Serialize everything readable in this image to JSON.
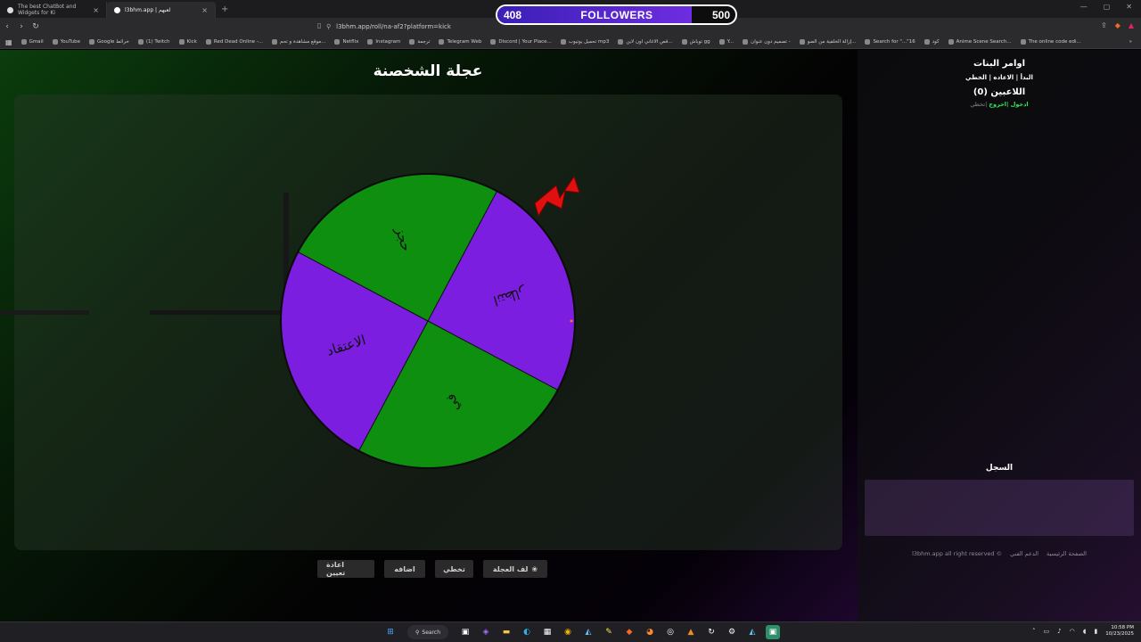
{
  "browser": {
    "tabs": [
      {
        "label": "The best ChatBot and Widgets for Ki"
      },
      {
        "label": "l3bhm.app | لعبهم"
      }
    ],
    "url": "l3bhm.app/roll/na-af2?platform=kick",
    "bookmarks": [
      "Gmail",
      "YouTube",
      "Google خرائط",
      "(1) Twitch",
      "Kick",
      "Red Dead Online -...",
      "موقع مشاهدة و تحم...",
      "Netflix",
      "Instagram",
      "ترجمة",
      "Telegram Web",
      "Discord | Your Place...",
      "تحميل يوتيوب mp3",
      "قص الاغاني اون لاين...",
      "توباش gg",
      "Y...",
      "تصميم دون عنوان -",
      "إزالة الخلفية من الصو...",
      "Search for \"...\"16",
      "كود",
      "Anime Scene Search...",
      "The online code edi..."
    ]
  },
  "followers_widget": {
    "current": "408",
    "label": "FOLLOWERS",
    "goal": "500",
    "progress": 0.816,
    "color": "#6d2de0"
  },
  "page": {
    "title": "عجلة الشخصنة",
    "wheel": {
      "segments": [
        {
          "label": "انتظار",
          "color": "#7c1ee0"
        },
        {
          "label": "في",
          "color": "#0f8f0f"
        },
        {
          "label": "الاعتقاد",
          "color": "#7c1ee0"
        },
        {
          "label": "حجز",
          "color": "#0f8f0f"
        }
      ],
      "pointer_color": "#e01010"
    },
    "buttons": {
      "spin": "لف العجلة",
      "skip": "تخطي",
      "add": "اضافه",
      "reassign": "اعادة تعيين"
    }
  },
  "sidebar": {
    "title": "اوامر البنات",
    "commands": "البدأ | الاعاده | الخطي",
    "players": "اللاعبين (0)",
    "join": "ادخول",
    "exit": "اخروج",
    "skip": "تخطي",
    "log_title": "السجل",
    "footer_home": "الصفحة الرئيسية",
    "footer_support": "الدعم الفني",
    "footer_copy": "l3bhm.app all right reserved ©"
  },
  "taskbar": {
    "search": "Search",
    "time": "10:58 PM",
    "date": "10/23/2025"
  }
}
